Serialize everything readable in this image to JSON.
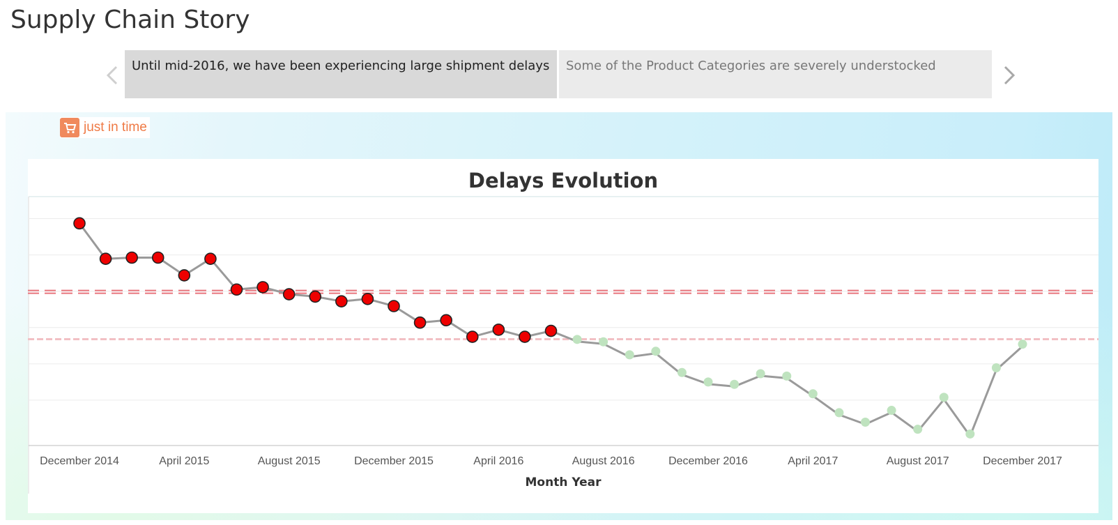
{
  "story": {
    "title": "Supply Chain Story",
    "points": [
      "Until mid-2016, we have been experiencing large shipment delays",
      "Some of the Product Categories are severely understocked"
    ]
  },
  "logo": {
    "text": "just in time",
    "icon": "cart-icon",
    "color": "#ef7a45"
  },
  "chart_data": {
    "type": "line",
    "title": "Delays Evolution",
    "xlabel": "Month Year",
    "ylabel": "",
    "x_tick_labels": [
      "December 2014",
      "April 2015",
      "August 2015",
      "December 2015",
      "April 2016",
      "August 2016",
      "December 2016",
      "April 2017",
      "August 2017",
      "December 2017"
    ],
    "x": [
      "December 2014",
      "January 2015",
      "February 2015",
      "March 2015",
      "April 2015",
      "May 2015",
      "June 2015",
      "July 2015",
      "August 2015",
      "September 2015",
      "October 2015",
      "November 2015",
      "December 2015",
      "January 2016",
      "February 2016",
      "March 2016",
      "April 2016",
      "May 2016",
      "June 2016",
      "July 2016",
      "August 2016",
      "September 2016",
      "October 2016",
      "November 2016",
      "December 2016",
      "January 2017",
      "February 2017",
      "March 2017",
      "April 2017",
      "May 2017",
      "June 2017",
      "July 2017",
      "August 2017",
      "September 2017",
      "October 2017",
      "November 2017",
      "December 2017"
    ],
    "values": [
      0.94,
      0.79,
      0.795,
      0.795,
      0.72,
      0.79,
      0.66,
      0.67,
      0.64,
      0.63,
      0.61,
      0.62,
      0.59,
      0.52,
      0.53,
      0.46,
      0.49,
      0.46,
      0.485,
      0.44,
      0.43,
      0.375,
      0.39,
      0.3,
      0.26,
      0.25,
      0.295,
      0.285,
      0.21,
      0.13,
      0.09,
      0.14,
      0.06,
      0.195,
      0.04,
      0.32,
      0.42
    ],
    "ylim": [
      0,
      1
    ],
    "y_ticks_shown": false,
    "reference_lines": [
      0.65,
      0.45
    ],
    "colors": {
      "line": "#9a9a9a",
      "above_threshold_marker": "#ee0000",
      "below_threshold_marker": "#bfe3bf",
      "reference_line": "#e8747c",
      "gridline": "#ececec"
    },
    "grid": true
  }
}
